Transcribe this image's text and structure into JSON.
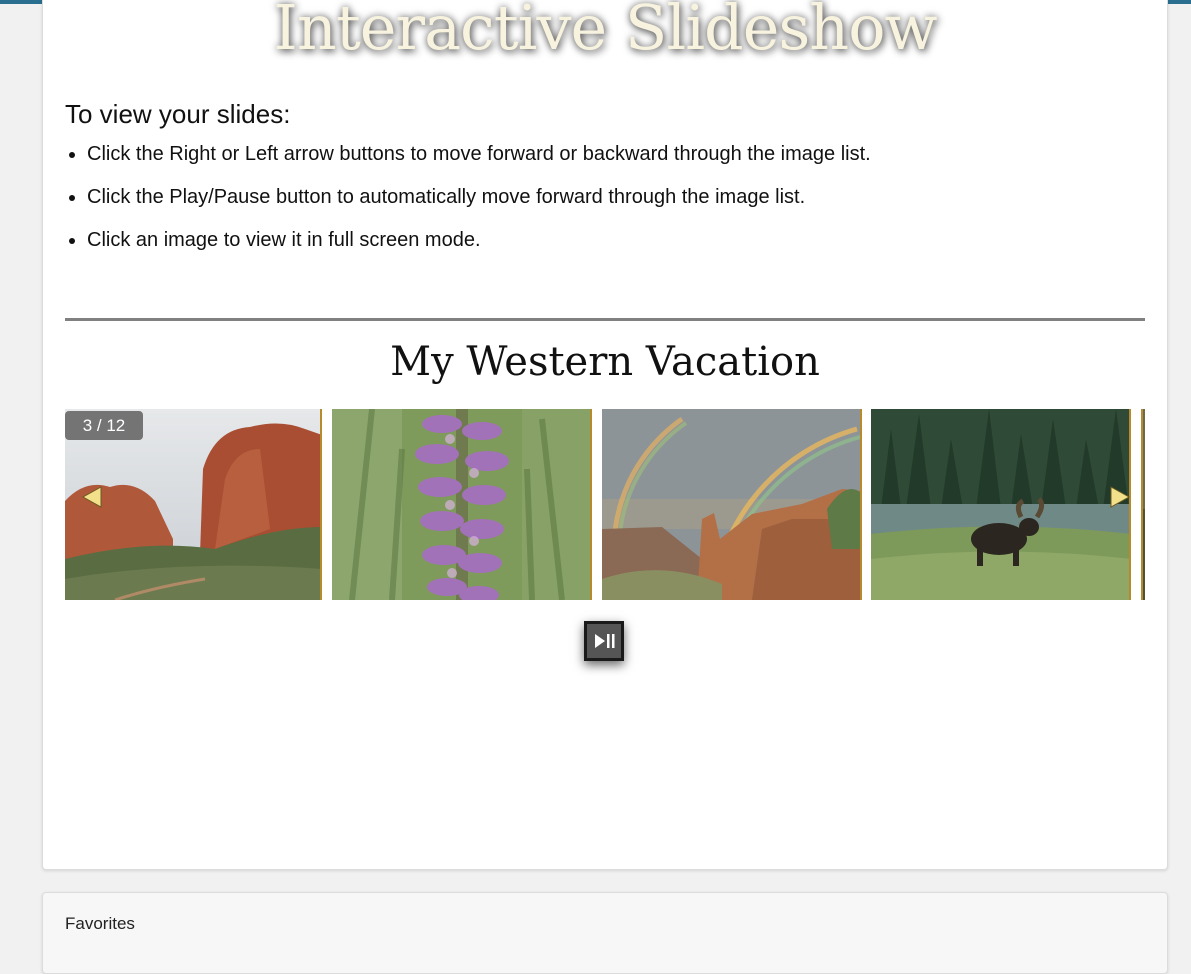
{
  "hero": {
    "title": "Interactive Slideshow"
  },
  "instructions": {
    "heading": "To view your slides:",
    "items": [
      "Click the Right or Left arrow buttons to move forward or backward through the image list.",
      "Click the Play/Pause button to automatically move forward through the image list.",
      "Click an image to view it in full screen mode."
    ]
  },
  "gallery": {
    "title": "My Western Vacation",
    "counter": "3 / 12",
    "slides": [
      {
        "subject": "red rock formations under cloudy sky"
      },
      {
        "subject": "purple orchid flower spike"
      },
      {
        "subject": "double rainbow over canyon"
      },
      {
        "subject": "moose in meadow by lake"
      }
    ],
    "prev_icon": "left-triangle",
    "next_icon": "right-triangle",
    "playpause_icon": "play-pause"
  },
  "favorites": {
    "heading": "Favorites"
  },
  "colors": {
    "topbar": "#2a6f8f",
    "arrow": "#f2e08a",
    "slide_border": "#b88a2e",
    "divider": "#808080"
  }
}
